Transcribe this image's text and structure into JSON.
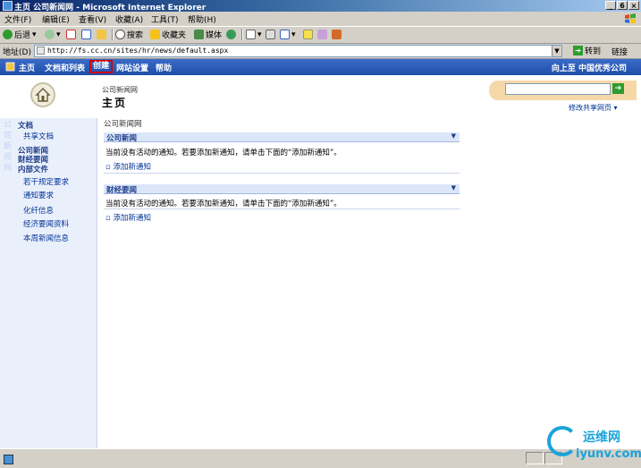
{
  "window": {
    "title": "主页  公司新闻网 - Microsoft Internet Explorer",
    "buttons": [
      "_",
      "6",
      "×"
    ]
  },
  "menubar": {
    "items": [
      "文件(F)",
      "编辑(E)",
      "查看(V)",
      "收藏(A)",
      "工具(T)",
      "帮助(H)"
    ]
  },
  "toolbar": {
    "back": "后退",
    "search": "搜索",
    "favorites": "收藏夹",
    "media": "媒体"
  },
  "address": {
    "label": "地址(D)",
    "url": "http://fs.cc.cn/sites/hr/news/default.aspx",
    "go": "转到",
    "links": "链接"
  },
  "spnav": {
    "items": [
      "主页",
      "文档和列表",
      "创建",
      "网站设置",
      "帮助"
    ],
    "upto": "向上至 中国优秀公司"
  },
  "header": {
    "breadcrumb": "公司新闻网",
    "title": "主页",
    "modify_link": "修改共享网页"
  },
  "leftnav": {
    "watermark": "公司新闻网",
    "items": [
      {
        "label": "文档",
        "head": true
      },
      {
        "label": "共享文档",
        "head": false
      },
      {
        "label": "公司新闻",
        "head": true
      },
      {
        "label": "财经要闻",
        "head": true
      },
      {
        "label": "内部文件",
        "head": true
      },
      {
        "label": "若干规定要求",
        "head": false
      },
      {
        "label": "通知要求",
        "head": false
      },
      {
        "label": "化纤信息",
        "head": false
      },
      {
        "label": "经济要闻资料",
        "head": false
      },
      {
        "label": "本周新闻信息",
        "head": false
      }
    ]
  },
  "main": {
    "group_label": "公司新闻网",
    "parts": [
      {
        "title": "公司新闻",
        "body": "当前没有活动的通知。若要添加新通知，请单击下面的“添加新通知”。",
        "add": "添加新通知"
      },
      {
        "title": "财经要闻",
        "body": "当前没有活动的通知。若要添加新通知，请单击下面的“添加新通知”。",
        "add": "添加新通知"
      }
    ]
  },
  "watermark_brand": {
    "cn": "运维网",
    "url": "iyunv.com"
  },
  "colors": {
    "nav": "#1f4ea8",
    "accent": "#d00000",
    "brand": "#1aa3d9",
    "search": "#f6d8a8"
  }
}
